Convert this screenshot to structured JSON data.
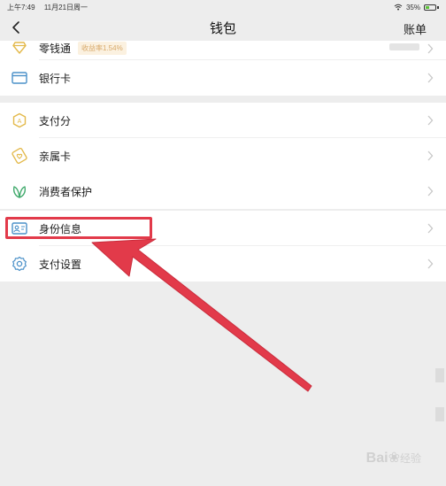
{
  "status_bar": {
    "time": "上午7:49",
    "date": "11月21日周一",
    "battery": "35%"
  },
  "nav": {
    "title": "钱包",
    "right": "账单"
  },
  "sections": [
    {
      "items": [
        {
          "label": "零钱通",
          "icon": "diamond-icon",
          "badge": "收益率1.54%"
        },
        {
          "label": "银行卡",
          "icon": "card-icon"
        }
      ]
    },
    {
      "items": [
        {
          "label": "支付分",
          "icon": "score-icon"
        },
        {
          "label": "亲属卡",
          "icon": "heart-card-icon"
        }
      ]
    },
    {
      "items": [
        {
          "label": "消费者保护",
          "icon": "leaf-shield-icon"
        }
      ]
    },
    {
      "items": [
        {
          "label": "身份信息",
          "icon": "id-card-icon"
        },
        {
          "label": "支付设置",
          "icon": "gear-icon"
        }
      ]
    }
  ],
  "watermark": {
    "brand": "Bai",
    "suffix": "经验"
  },
  "colors": {
    "accent_red": "#e23a4a",
    "icon_blue": "#4a90c8",
    "icon_gold": "#e3b94a",
    "icon_green": "#3fa96b"
  }
}
